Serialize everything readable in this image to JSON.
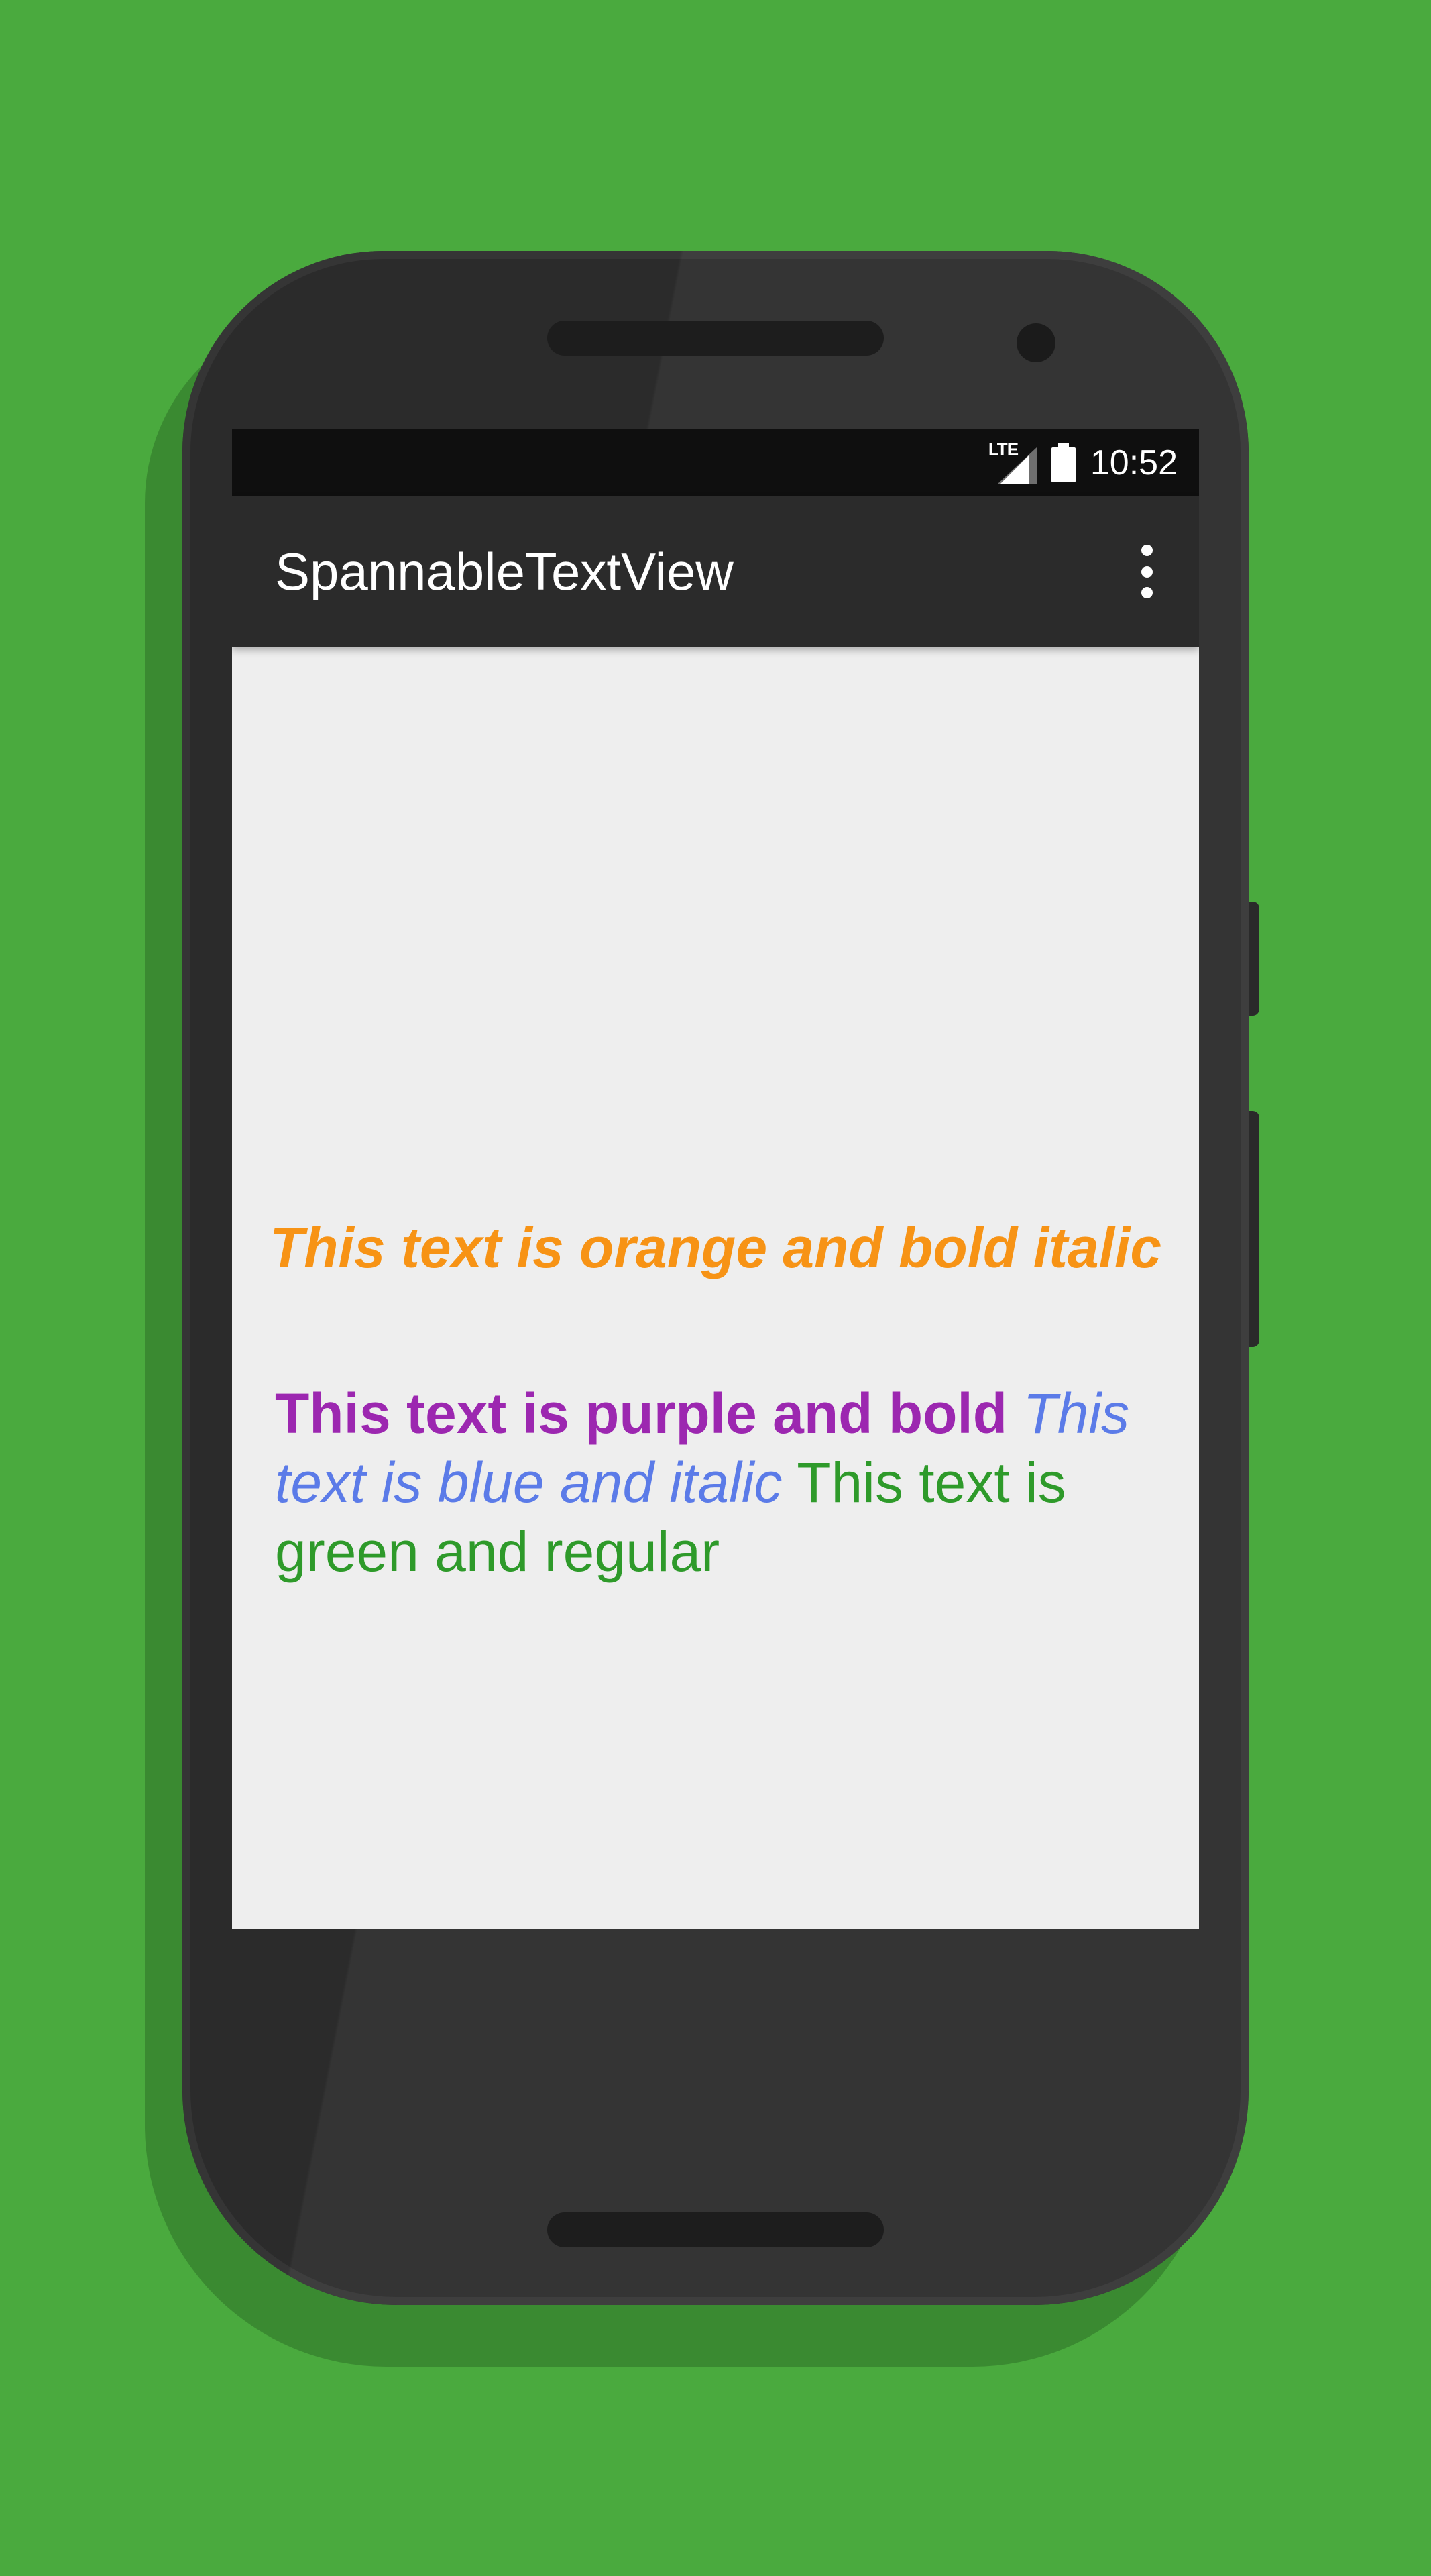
{
  "status_bar": {
    "network_type": "LTE",
    "time": "10:52",
    "icons": [
      "lte-signal-icon",
      "battery-icon"
    ]
  },
  "app_bar": {
    "title": "SpannableTextView",
    "overflow_icon": "more-vert-icon"
  },
  "content": {
    "orange_text": "This text is orange and bold italic",
    "spans": [
      {
        "text": "This text is purple and bold",
        "color": "#9c27b0",
        "style": "bold"
      },
      {
        "text": "This text is blue and italic",
        "color": "#5b7be8",
        "style": "italic"
      },
      {
        "text": "This text is green and regular",
        "color": "#2e9a2a",
        "style": "regular"
      }
    ]
  },
  "colors": {
    "background": "#4aaa3e",
    "device_body": "#2b2b2b",
    "screen_background": "#eeeeee",
    "orange": "#f79315"
  }
}
